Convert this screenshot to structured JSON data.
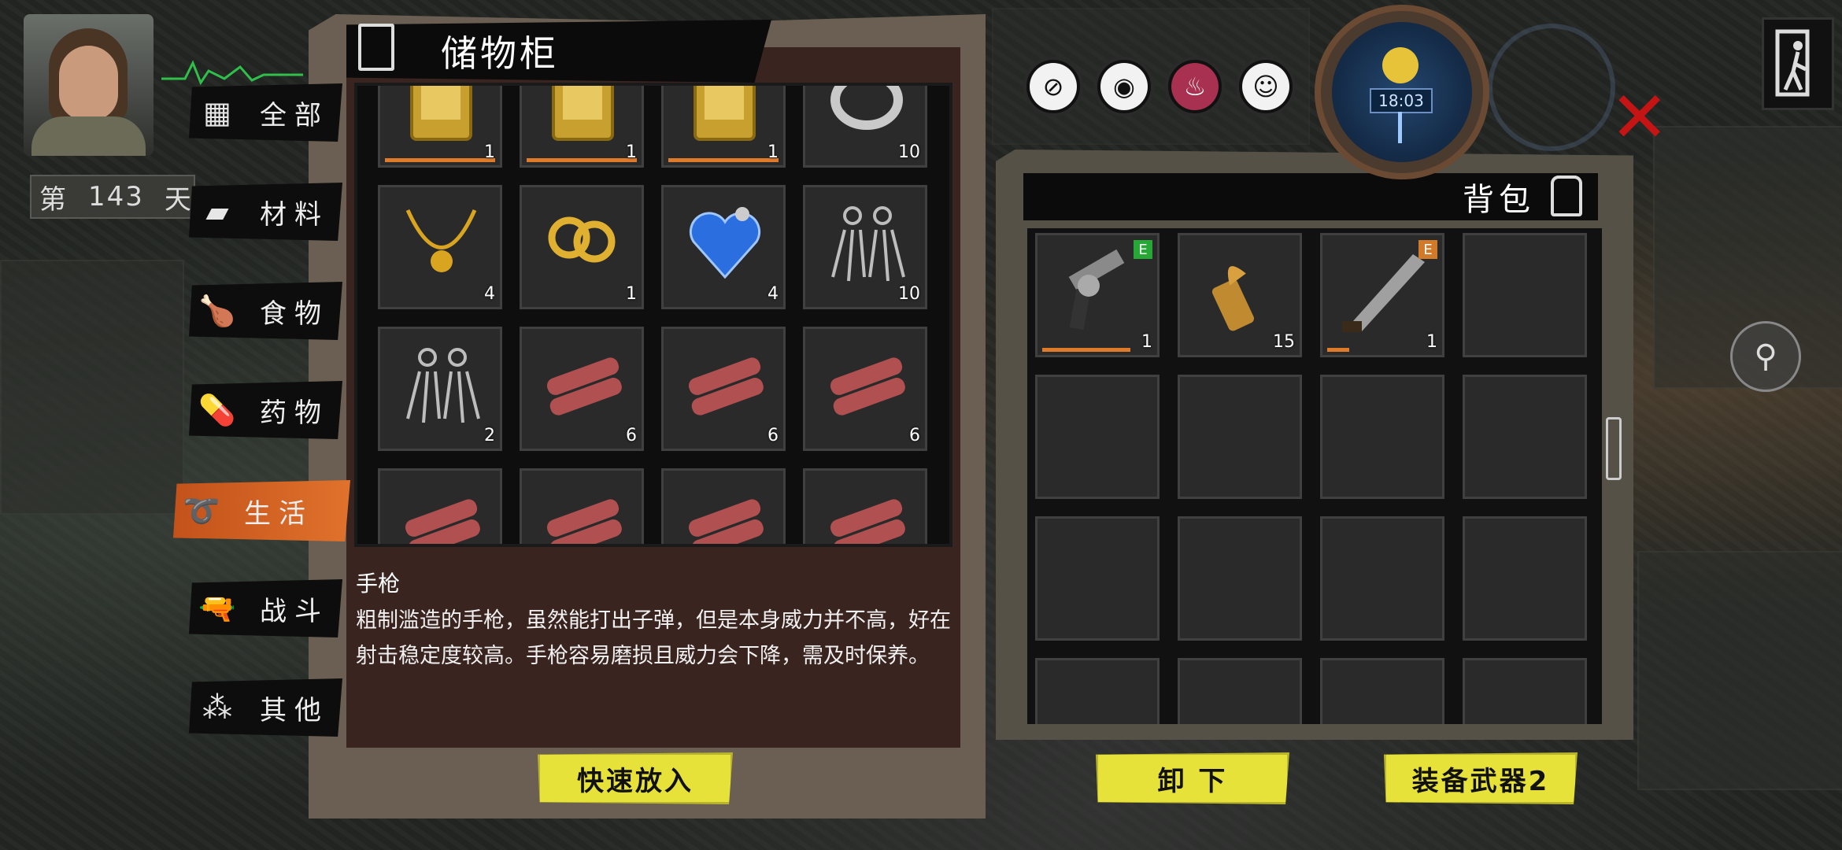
{
  "day": {
    "prefix": "第",
    "number": "143",
    "suffix": "天"
  },
  "categories": [
    {
      "label": "全部",
      "icon": "grid-icon",
      "glyph": "▦"
    },
    {
      "label": "材料",
      "icon": "planks-icon",
      "glyph": "▰"
    },
    {
      "label": "食物",
      "icon": "chicken-icon",
      "glyph": "🍗"
    },
    {
      "label": "药物",
      "icon": "pill-bottle-icon",
      "glyph": "💊"
    },
    {
      "label": "生活",
      "icon": "rings-icon",
      "glyph": "➰",
      "active": true
    },
    {
      "label": "战斗",
      "icon": "pistol-icon",
      "glyph": "🔫"
    },
    {
      "label": "其他",
      "icon": "dots-icon",
      "glyph": "⁂"
    }
  ],
  "storage": {
    "title": "储物柜",
    "items": [
      {
        "name": "gold-box",
        "count": "1",
        "bar": 1.0,
        "color": "#c8a030"
      },
      {
        "name": "gold-box",
        "count": "1",
        "bar": 1.0,
        "color": "#c8a030"
      },
      {
        "name": "gold-box",
        "count": "1",
        "bar": 1.0,
        "color": "#c8a030"
      },
      {
        "name": "silver-ring",
        "count": "10",
        "color": "#c9c9c9"
      },
      {
        "name": "gold-necklace",
        "count": "4",
        "color": "#d9a520"
      },
      {
        "name": "gold-brooch",
        "count": "1",
        "color": "#e0b030"
      },
      {
        "name": "blue-heart-pendant",
        "count": "4",
        "color": "#2a6ee0"
      },
      {
        "name": "silver-earrings",
        "count": "10",
        "color": "#bdbdbd"
      },
      {
        "name": "silver-earrings",
        "count": "2",
        "color": "#bdbdbd"
      },
      {
        "name": "dynamite",
        "count": "6",
        "color": "#b05050"
      },
      {
        "name": "dynamite",
        "count": "6",
        "color": "#b05050"
      },
      {
        "name": "dynamite",
        "count": "6",
        "color": "#b05050"
      },
      {
        "name": "dynamite",
        "count": "",
        "color": "#b05050"
      },
      {
        "name": "dynamite",
        "count": "",
        "color": "#b05050"
      },
      {
        "name": "dynamite",
        "count": "",
        "color": "#b05050"
      },
      {
        "name": "dynamite",
        "count": "",
        "color": "#b05050"
      }
    ]
  },
  "description": {
    "name": "手枪",
    "text": "粗制滥造的手枪，虽然能打出子弹，但是本身威力并不高，好在射击稳定度较高。手枪容易磨损且威力会下降，需及时保养。"
  },
  "buttons": {
    "quick_put": "快速放入",
    "unload": "卸 下",
    "equip": "装备武器2"
  },
  "backpack": {
    "title": "背包",
    "items": [
      {
        "name": "revolver",
        "count": "1",
        "bar": 0.8,
        "badge": "E",
        "badge_color": "#27a836",
        "color": "#8a8a8a"
      },
      {
        "name": "bullet",
        "count": "15",
        "color": "#c08a30"
      },
      {
        "name": "machete",
        "count": "1",
        "bar": 0.2,
        "badge": "E",
        "badge_color": "#d07a2a",
        "color": "#a0a0a0"
      }
    ],
    "total_slots": 16
  },
  "clock": {
    "time": "18:03"
  },
  "status_icons": [
    {
      "name": "pills-status-icon",
      "glyph": "⊘"
    },
    {
      "name": "eye-status-icon",
      "glyph": "◉"
    },
    {
      "name": "stomach-status-icon",
      "glyph": "♨"
    },
    {
      "name": "mood-status-icon",
      "glyph": "☺"
    }
  ]
}
